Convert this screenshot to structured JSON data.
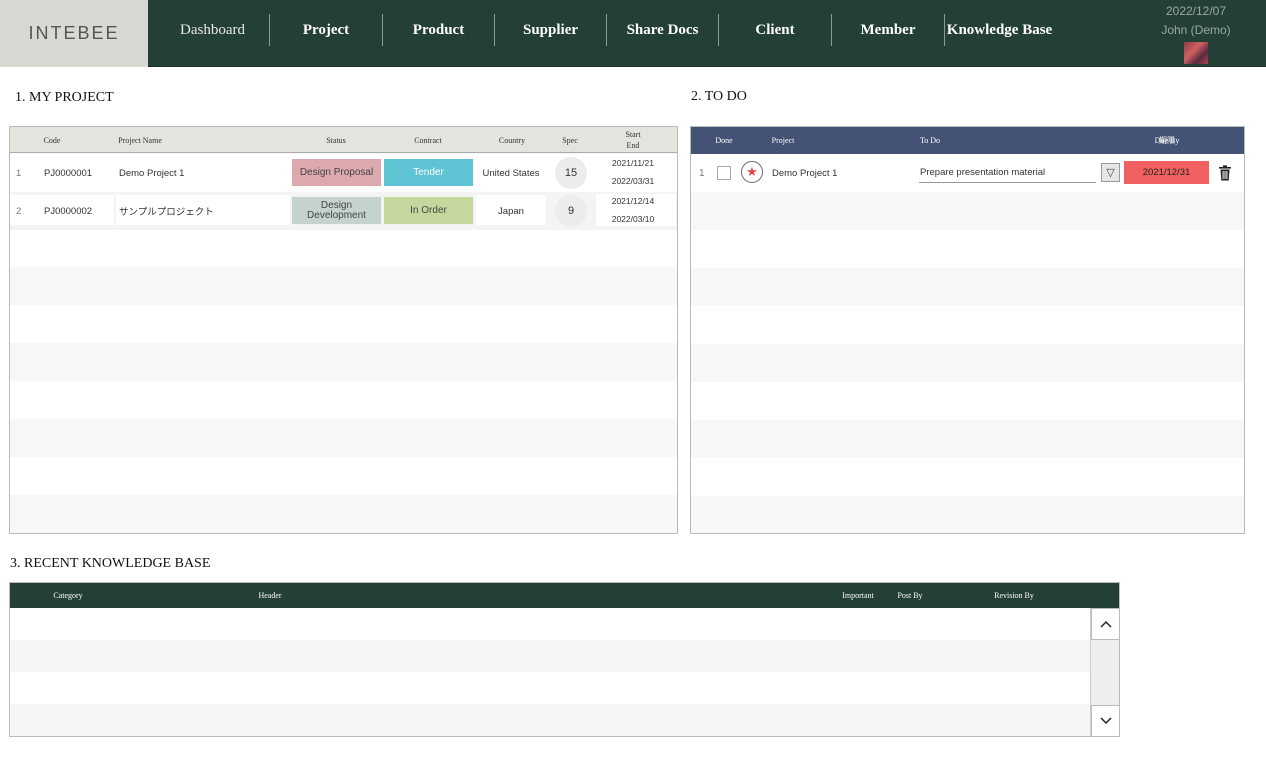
{
  "header": {
    "logo": "INTEBEE",
    "nav": [
      {
        "label": "Dashboard"
      },
      {
        "label": "Project"
      },
      {
        "label": "Product"
      },
      {
        "label": "Supplier"
      },
      {
        "label": "Share Docs"
      },
      {
        "label": "Client"
      },
      {
        "label": "Member"
      },
      {
        "label": "Knowledge Base"
      }
    ],
    "date": "2022/12/07",
    "user": "John (Demo)"
  },
  "my_project": {
    "title": "1. MY PROJECT",
    "columns": {
      "code": "Code",
      "name": "Project Name",
      "status": "Status",
      "contract": "Contract",
      "country": "Country",
      "spec": "Spec",
      "start": "Start",
      "end": "End"
    },
    "rows": [
      {
        "num": "1",
        "code": "PJ0000001",
        "name": "Demo Project 1",
        "status": "Design Proposal",
        "status_color": "#dcaaae",
        "contract": "Tender",
        "contract_color": "#5ec4d4",
        "country": "United States",
        "spec": "15",
        "start": "2021/11/21",
        "end": "2022/03/31"
      },
      {
        "num": "2",
        "code": "PJ0000002",
        "name": "サンプルプロジェクト",
        "status": "Design\nDevelopment",
        "status_color": "#c4d4cc",
        "contract": "In Order",
        "contract_color": "#c4d89e",
        "country": "Japan",
        "spec": "9",
        "start": "2021/12/14",
        "end": "2022/03/10"
      }
    ]
  },
  "todo": {
    "title": "2. TO DO",
    "columns": {
      "done": "Done",
      "project": "Project",
      "todo": "To Do",
      "due": "Due By",
      "due_overlay": "期限"
    },
    "rows": [
      {
        "num": "1",
        "project": "Demo Project 1",
        "todo": "Prepare presentation material",
        "due": "2021/12/31"
      }
    ]
  },
  "knowledge": {
    "title": "3. RECENT KNOWLEDGE BASE",
    "columns": {
      "category": "Category",
      "header": "Header",
      "important": "Important",
      "post_by": "Post By",
      "revision_by": "Revision By"
    }
  },
  "colors": {
    "topbar": "#243f36",
    "todo_header": "#435275",
    "kb_header": "#243f36",
    "project_header": "#e4e3de",
    "due_overdue": "#f06060"
  }
}
